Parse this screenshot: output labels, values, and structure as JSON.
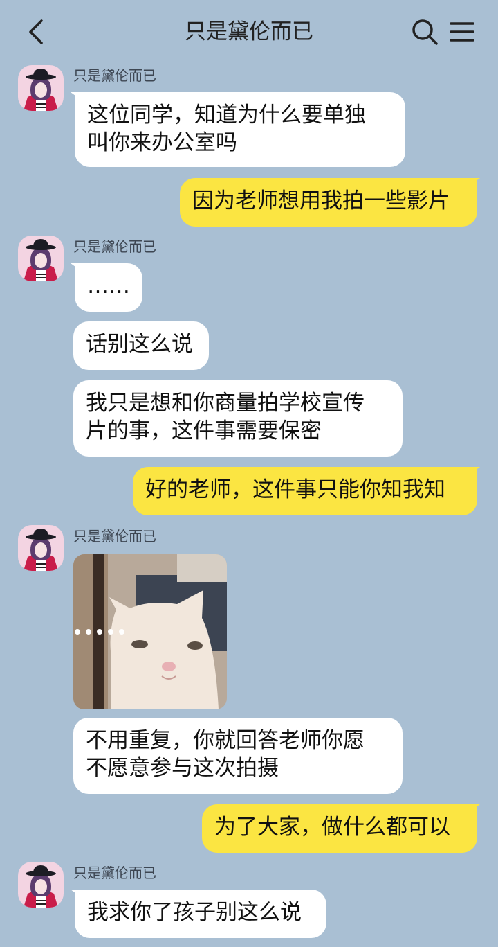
{
  "header": {
    "title": "只是黛伦而已",
    "back_icon": "chevron-left-icon",
    "search_icon": "search-icon",
    "menu_icon": "menu-icon"
  },
  "colors": {
    "background": "#a9bfd3",
    "incoming_bubble": "#ffffff",
    "outgoing_bubble": "#fbe542"
  },
  "messages": [
    {
      "sender": "只是黛伦而已",
      "lines": [
        "这位同学，知道为什么要单独",
        "叫你来办公室吗"
      ]
    },
    {
      "text": "因为老师想用我拍一些影片"
    },
    {
      "sender": "只是黛伦而已",
      "text": "……"
    },
    {
      "text": "话别这么说"
    },
    {
      "lines": [
        "我只是想和你商量拍学校宣传",
        "片的事，这件事需要保密"
      ]
    },
    {
      "text": "好的老师，这件事只能你知我知"
    },
    {
      "sender": "只是黛伦而已",
      "sticker": "cat-meme-image"
    },
    {
      "lines": [
        "不用重复，你就回答老师你愿",
        "不愿意参与这次拍摄"
      ]
    },
    {
      "text": "为了大家，做什么都可以"
    },
    {
      "sender": "只是黛伦而已",
      "text": "我求你了孩子别这么说"
    }
  ]
}
